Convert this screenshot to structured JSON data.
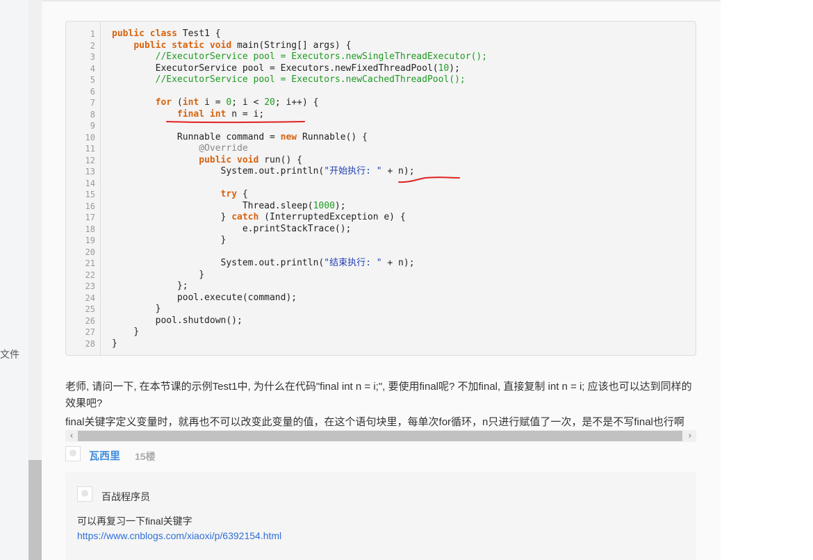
{
  "sidebar": {
    "label": "文件"
  },
  "code": {
    "line_numbers": [
      "1",
      "2",
      "3",
      "4",
      "5",
      "6",
      "7",
      "8",
      "9",
      "10",
      "11",
      "12",
      "13",
      "14",
      "15",
      "16",
      "17",
      "18",
      "19",
      "20",
      "21",
      "22",
      "23",
      "24",
      "25",
      "26",
      "27",
      "28"
    ]
  },
  "question": {
    "text": "老师, 请问一下, 在本节课的示例Test1中, 为什么在代码\"final int n = i;\", 要使用final呢? 不加final, 直接复制 int n = i; 应该也可以达到同样的效果吧?",
    "followup": "final关键字定义变量时，就再也不可以改变此变量的值，在这个语句块里，每单次for循环，n只进行赋值了一次，是不是不写final也行啊"
  },
  "scrollbar": {
    "left_arrow": "‹",
    "right_arrow": "›"
  },
  "comment": {
    "username": "瓦西里",
    "floor": "15楼"
  },
  "reply": {
    "author": "百战程序员",
    "text": "可以再复习一下final关键字",
    "link": "https://www.cnblogs.com/xiaoxi/p/6392154.html"
  },
  "colors": {
    "keyword": "#d7630e",
    "comment": "#1f9a1f",
    "string": "#1f3fb0",
    "username": "#3f8ce0",
    "link": "#2f6fd6",
    "annotation_red": "#e02020"
  }
}
